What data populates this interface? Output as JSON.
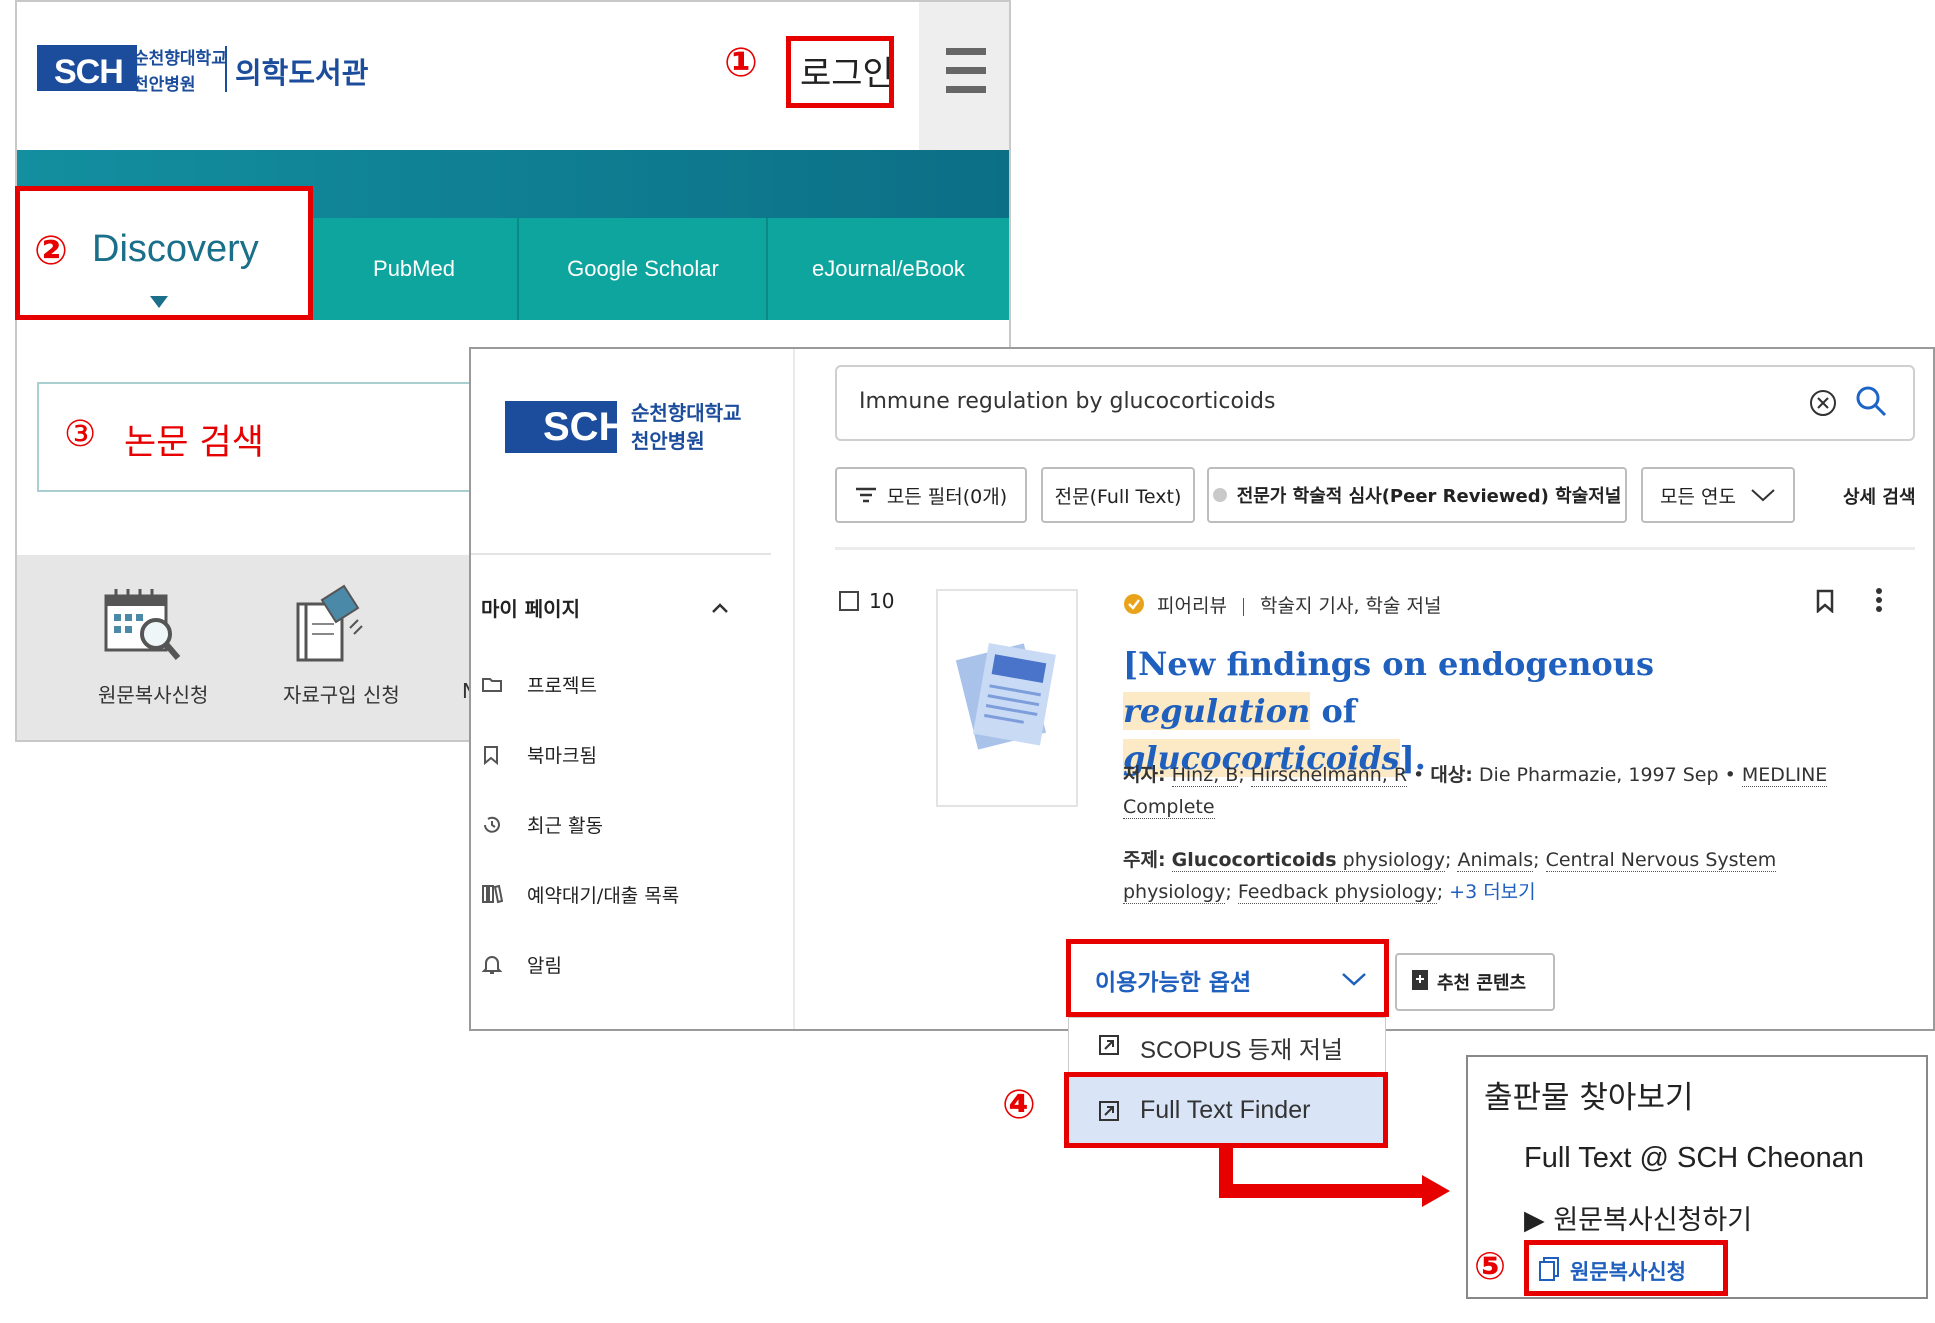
{
  "library_site": {
    "logo": {
      "abbr": "SCH",
      "hospital_line1": "순천향대학교",
      "hospital_line2": "천안병원",
      "library_name": "의학도서관"
    },
    "login_label": "로그인",
    "tabs": [
      {
        "label": "Discovery"
      },
      {
        "label": "PubMed"
      },
      {
        "label": "Google Scholar"
      },
      {
        "label": "eJournal/eBook"
      }
    ],
    "search_label": "논문 검색",
    "services": [
      {
        "label": "원문복사신청",
        "icon": "calendar-search-icon"
      },
      {
        "label": "자료구입 신청",
        "icon": "book-request-icon"
      },
      {
        "label": "N",
        "icon": "more-icon"
      }
    ]
  },
  "discovery": {
    "logo": {
      "abbr": "SCH",
      "line1": "순천향대학교",
      "line2": "천안병원"
    },
    "search_query": "Immune regulation by glucocorticoids",
    "filters": {
      "all_filters": "모든 필터(0개)",
      "full_text": "전문(Full Text)",
      "peer_reviewed": "전문가 학술적 심사(Peer Reviewed) 학술저널",
      "all_years": "모든 연도",
      "advanced": "상세 검색"
    },
    "sidebar": {
      "heading": "마이 페이지",
      "items": [
        {
          "label": "프로젝트",
          "icon": "folder-icon"
        },
        {
          "label": "북마크됨",
          "icon": "bookmark-icon"
        },
        {
          "label": "최근 활동",
          "icon": "history-icon"
        },
        {
          "label": "예약대기/대출 목록",
          "icon": "books-icon"
        },
        {
          "label": "알림",
          "icon": "bell-icon"
        }
      ]
    },
    "result": {
      "number": "10",
      "source_type_peer": "피어리뷰",
      "source_type_rest": "학술지 기사, 학술 저널",
      "title_part1": "[New findings on endogenous ",
      "title_hl1": "regulation",
      "title_part2": " of ",
      "title_hl2": "glucocorticoids",
      "title_part3": "].",
      "authors_label": "저자:",
      "author1": "Hinz, B",
      "author2": "Hirschelmann, R",
      "source_label": "대상:",
      "source": "Die Pharmazie, 1997 Sep",
      "database_part1": "MEDLINE",
      "database_part2": "Complete",
      "subjects_label": "주제:",
      "subject1_bold": "Glucocorticoids",
      "subject1_rest": " physiology",
      "subject2": "Animals",
      "subject3_part1": "Central Nervous System",
      "subject3_part2": "physiology",
      "subject4": "Feedback physiology",
      "more": "+3 더보기",
      "options_label": "이용가능한 옵션",
      "recommend_label": "추천 콘텐츠"
    },
    "dropdown": [
      {
        "label": "SCOPUS 등재 저널"
      },
      {
        "label": "Full Text Finder"
      }
    ]
  },
  "publication_finder": {
    "title": "출판물 찾아보기",
    "full_text": "Full Text @ SCH Cheonan",
    "order_heading": "▶ 원문복사신청하기",
    "order_link": "원문복사신청"
  },
  "steps": [
    "①",
    "②",
    "③",
    "④",
    "⑤"
  ],
  "colors": {
    "highlight_red": "#e60000",
    "brand_blue": "#1c4d9c",
    "teal": "#0ea59e",
    "link_blue": "#1f5fbe"
  }
}
